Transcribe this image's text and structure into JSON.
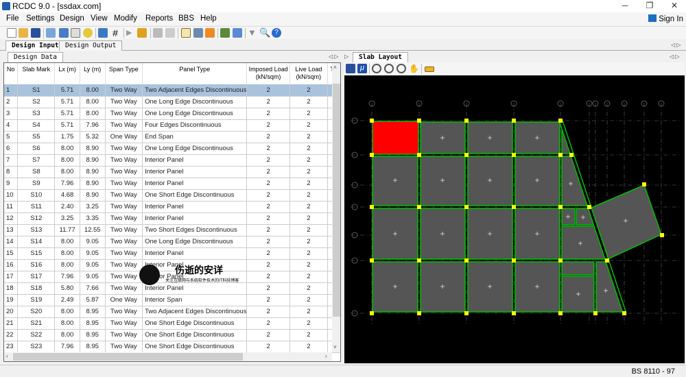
{
  "window": {
    "title": "RCDC 9.0 - [ssdax.com]",
    "minimize": "─",
    "restore": "❐",
    "close": "✕"
  },
  "menu": [
    "File",
    "Settings",
    "Design",
    "View",
    "Modify",
    "Reports",
    "BBS",
    "Help"
  ],
  "sign_in": "Sign In",
  "toolbar_icons": [
    "new-icon",
    "open-icon",
    "save-icon",
    "edit-icon",
    "list-icon",
    "print-icon",
    "palette-icon",
    "monitor-icon",
    "grid-icon",
    "run-icon",
    "lock-icon",
    "table-icon",
    "check-icon",
    "clipboard-icon",
    "copy-icon",
    "layout-icon",
    "tools-icon",
    "spreadsheet-icon",
    "filter-icon",
    "search-icon",
    "help-icon"
  ],
  "tabs": {
    "main": [
      "Design Input",
      "Design Output"
    ],
    "left_sub": "Design Data",
    "right": "Slab Layout"
  },
  "table": {
    "columns": [
      "No",
      "Slab Mark",
      "Lx (m)",
      "Ly (m)",
      "Span Type",
      "Panel Type",
      "Imposed Load (kN/sqm)",
      "Live Load (kN/sqm)",
      "Th"
    ],
    "selected_row": 1,
    "rows": [
      [
        "1",
        "S1",
        "5.71",
        "8.00",
        "Two Way",
        "Two Adjacent Edges Discontinuous",
        "2",
        "2"
      ],
      [
        "2",
        "S2",
        "5.71",
        "8.00",
        "Two Way",
        "One Long Edge Discontinuous",
        "2",
        "2"
      ],
      [
        "3",
        "S3",
        "5.71",
        "8.00",
        "Two Way",
        "One Long Edge Discontinuous",
        "2",
        "2"
      ],
      [
        "4",
        "S4",
        "5.71",
        "7.96",
        "Two Way",
        "Four Edges Discontinuous",
        "2",
        "2"
      ],
      [
        "5",
        "S5",
        "1.75",
        "5.32",
        "One Way",
        "End Span",
        "2",
        "2"
      ],
      [
        "6",
        "S6",
        "8.00",
        "8.90",
        "Two Way",
        "One Long Edge Discontinuous",
        "2",
        "2"
      ],
      [
        "7",
        "S7",
        "8.00",
        "8.90",
        "Two Way",
        "Interior Panel",
        "2",
        "2"
      ],
      [
        "8",
        "S8",
        "8.00",
        "8.90",
        "Two Way",
        "Interior Panel",
        "2",
        "2"
      ],
      [
        "9",
        "S9",
        "7.96",
        "8.90",
        "Two Way",
        "Interior Panel",
        "2",
        "2"
      ],
      [
        "10",
        "S10",
        "4.68",
        "8.90",
        "Two Way",
        "One Short Edge Discontinuous",
        "2",
        "2"
      ],
      [
        "11",
        "S11",
        "2.40",
        "3.25",
        "Two Way",
        "Interior Panel",
        "2",
        "2"
      ],
      [
        "12",
        "S12",
        "3.25",
        "3.35",
        "Two Way",
        "Interior Panel",
        "2",
        "2"
      ],
      [
        "13",
        "S13",
        "11.77",
        "12.55",
        "Two Way",
        "Two Short Edges Discontinuous",
        "2",
        "2"
      ],
      [
        "14",
        "S14",
        "8.00",
        "9.05",
        "Two Way",
        "One Long Edge Discontinuous",
        "2",
        "2"
      ],
      [
        "15",
        "S15",
        "8.00",
        "9.05",
        "Two Way",
        "Interior Panel",
        "2",
        "2"
      ],
      [
        "16",
        "S16",
        "8.00",
        "9.05",
        "Two Way",
        "Interior Panel",
        "2",
        "2"
      ],
      [
        "17",
        "S17",
        "7.96",
        "9.05",
        "Two Way",
        "Interior Panel",
        "2",
        "2"
      ],
      [
        "18",
        "S18",
        "5.80",
        "7.66",
        "Two Way",
        "Interior Panel",
        "2",
        "2"
      ],
      [
        "19",
        "S19",
        "2.49",
        "5.87",
        "One Way",
        "Interior Span",
        "2",
        "2"
      ],
      [
        "20",
        "S20",
        "8.00",
        "8.95",
        "Two Way",
        "Two Adjacent Edges Discontinuous",
        "2",
        "2"
      ],
      [
        "21",
        "S21",
        "8.00",
        "8.95",
        "Two Way",
        "One Short Edge Discontinuous",
        "2",
        "2"
      ],
      [
        "22",
        "S22",
        "8.00",
        "8.95",
        "Two Way",
        "One Short Edge Discontinuous",
        "2",
        "2"
      ],
      [
        "23",
        "S23",
        "7.96",
        "8.95",
        "Two Way",
        "One Short Edge Discontinuous",
        "2",
        "2"
      ]
    ]
  },
  "layout_toolbar_icons": [
    "save-icon",
    "mu-icon",
    "zoom-window-icon",
    "zoom-extents-icon",
    "zoom-icon",
    "pan-icon",
    "measure-icon"
  ],
  "layout_colors": {
    "background": "#000000",
    "slab": "#555555",
    "selected_slab": "#ff0000",
    "beam": "#00c000",
    "column": "#ffff00"
  },
  "watermark": {
    "title": "伤逝的安详",
    "subtitle": "关注互联网与系统软件技术的IT科技博客"
  },
  "status": "BS 8110 - 97"
}
